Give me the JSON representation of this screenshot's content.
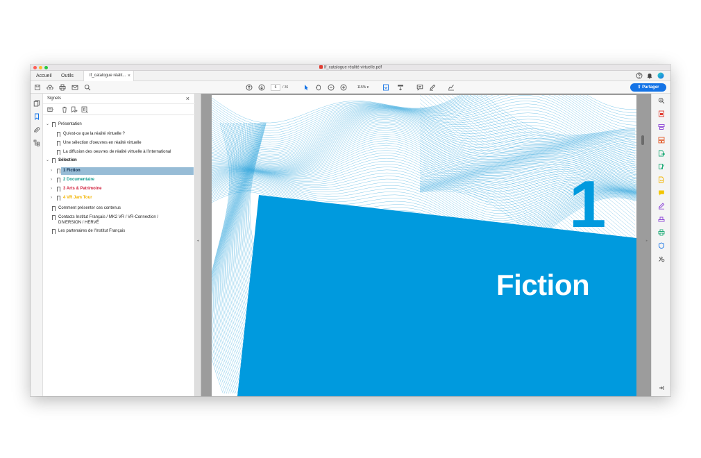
{
  "window": {
    "title": "If_catalogue réalité virtuelle.pdf",
    "traffic": {
      "close": "#ff5f57",
      "minimize": "#febc2e",
      "zoom": "#28c840"
    }
  },
  "tabs": {
    "home": "Accueil",
    "tools": "Outils",
    "document": "If_catalogue réalit...",
    "close_glyph": "×"
  },
  "toolbar": {
    "current_page": "6",
    "total_pages": "/ 36",
    "zoom": "115%",
    "share_label": "Partager"
  },
  "bookmarks_panel": {
    "title": "Signets",
    "close_glyph": "×",
    "items": [
      {
        "label": "Présentation",
        "level": 0,
        "expandable": true,
        "expanded": true,
        "color": "#222222",
        "bold": false
      },
      {
        "label": "Qu'est-ce que la réalité virtuelle ?",
        "level": 1,
        "expandable": false,
        "color": "#222222",
        "bold": false
      },
      {
        "label": "Une sélection d'oeuvres en réalité virtuelle",
        "level": 1,
        "expandable": false,
        "color": "#222222",
        "bold": false
      },
      {
        "label": "La diffusion des oeuvres de réalité virtuelle à l'international",
        "level": 1,
        "expandable": false,
        "color": "#222222",
        "bold": false
      },
      {
        "label": "Sélection",
        "level": 0,
        "expandable": true,
        "expanded": true,
        "color": "#111111",
        "bold": true
      },
      {
        "label": "1 Fiction",
        "level": 1,
        "expandable": true,
        "expanded": false,
        "color": "#0c2a4a",
        "bold": true,
        "selected": true
      },
      {
        "label": "2 Documentaire",
        "level": 1,
        "expandable": true,
        "expanded": false,
        "color": "#0f9a8e",
        "bold": true
      },
      {
        "label": "3 Arts & Patrimoine",
        "level": 1,
        "expandable": true,
        "expanded": false,
        "color": "#d0213d",
        "bold": true
      },
      {
        "label": "4 VR Jam Tour",
        "level": 1,
        "expandable": true,
        "expanded": false,
        "color": "#f2b400",
        "bold": true
      },
      {
        "label": "Comment présenter ces contenus",
        "level": 0,
        "expandable": false,
        "color": "#222222",
        "bold": false
      },
      {
        "label": "Contacts Institut Français / MK2 VR / VR-Connection /",
        "label2": "DIVERSION / HERVÉ",
        "level": 0,
        "expandable": false,
        "color": "#222222",
        "bold": false
      },
      {
        "label": "Les partenaires de l'Institut Français",
        "level": 0,
        "expandable": false,
        "color": "#222222",
        "bold": false
      }
    ]
  },
  "page": {
    "chapter_number": "1",
    "chapter_title": "Fiction",
    "page_number": "6",
    "accent": "#009ade",
    "line_color": "#1a9ad8"
  },
  "colors": {
    "brand_blue": "#1473e6",
    "selection": "#97bcd6"
  }
}
